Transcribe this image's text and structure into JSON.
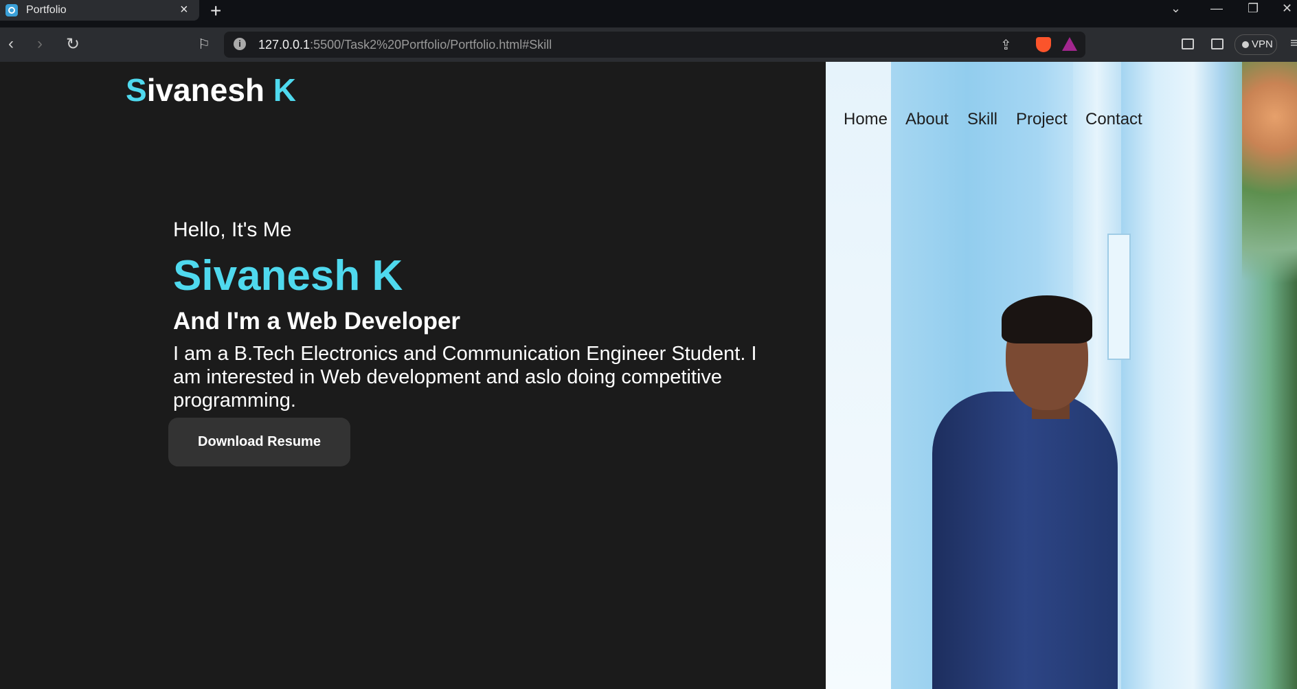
{
  "browser": {
    "tab_title": "Portfolio",
    "tab_close": "×",
    "new_tab": "+",
    "url_host": "127.0.0.1",
    "url_path": ":5500/Task2%20Portfolio/Portfolio.html#Skill",
    "vpn_label": "VPN",
    "icons": {
      "back": "back-arrow-icon",
      "forward": "forward-arrow-icon",
      "reload": "reload-icon",
      "bookmark": "bookmark-icon",
      "info": "site-info-icon",
      "share": "share-icon",
      "brave": "brave-shields-icon",
      "rewards": "brave-rewards-icon",
      "sidebar": "sidebar-toggle-icon",
      "wallet": "wallet-icon",
      "minimize": "minimize-icon",
      "restore": "restore-icon",
      "close": "close-window-icon",
      "tab_search": "tab-search-chevron-icon"
    }
  },
  "site": {
    "logo_first_letter": "S",
    "logo_middle": "ivanesh ",
    "logo_last": "K",
    "nav": [
      "Home",
      "About",
      "Skill",
      "Project",
      "Contact"
    ],
    "hero": {
      "greeting": "Hello, It's Me",
      "name": "Sivanesh K",
      "role": "And I'm a Web Developer",
      "bio": "I am a B.Tech Electronics and Communication Engineer Student. I am interested in Web development and aslo doing competitive programming.",
      "button": "Download Resume"
    },
    "colors": {
      "accent": "#4fd9ee",
      "background": "#1b1b1b",
      "button_bg": "#333333"
    }
  }
}
